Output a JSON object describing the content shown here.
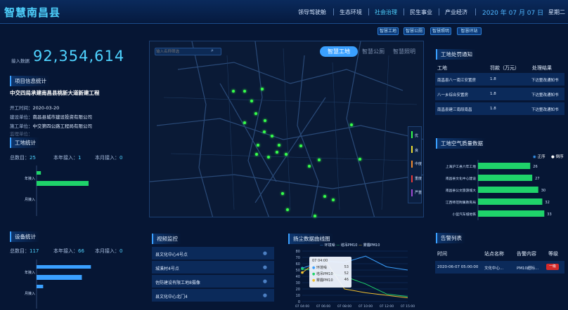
{
  "header": {
    "title": "智慧南昌县",
    "nav": [
      "领导驾驶舱",
      "生态环境",
      "社会治理",
      "民生事业",
      "产业经济"
    ],
    "nav_active": 2,
    "date": "2020 年 07 月 07 日",
    "weekday": "星期二"
  },
  "subnav": [
    "智慧工地",
    "智慧公厕",
    "智慧照明",
    "智慧环站"
  ],
  "left": {
    "access_label": "接入数据",
    "access_value": "92,354,614",
    "project": {
      "section": "项目信息统计",
      "name": "中交四局承建南昌县桃新大道新建工程",
      "start_label": "开工时间：",
      "start": "2020-03-20",
      "build_label": "建设单位：",
      "build": "南昌县城市建设投资有限公司",
      "construct_label": "施工单位：",
      "construct": "中交第四公路工程局有限公司",
      "extra_label": "监理单位："
    },
    "site": {
      "section": "工地统计",
      "total_label": "总数目：",
      "total": "25",
      "year_label": "本年接入：",
      "year": "1",
      "month_label": "本月接入：",
      "month": "0",
      "bars": [
        {
          "label": "年接入",
          "value": 1
        },
        {
          "label": "年接入",
          "value": 12
        },
        {
          "label": "月接入",
          "value": 0
        }
      ],
      "ticks": [
        "0",
        "2",
        "4",
        "6",
        "8",
        "10",
        "12"
      ]
    },
    "device": {
      "section": "设备统计",
      "total_label": "总数目：",
      "total": "117",
      "year_label": "本年接入：",
      "year": "66",
      "month_label": "本月接入：",
      "month": "0",
      "bars": [
        {
          "label": "年接入",
          "value": 66
        },
        {
          "label": "年接入",
          "value": 55
        },
        {
          "label": "月接入",
          "value": 8
        }
      ],
      "ticks": [
        "0",
        "10",
        "20",
        "30",
        "40",
        "50",
        "60",
        "70"
      ]
    }
  },
  "map": {
    "search_placeholder": "输入名称筛选",
    "tabs": [
      "智慧工地",
      "智慧公厕",
      "智慧照明"
    ],
    "legend": [
      "优",
      "良",
      "中度",
      "重度",
      "严重"
    ]
  },
  "video": {
    "section": "视频监控",
    "items": [
      "县文化中心4号点",
      "城溪村4号点",
      "佐防建设有限工地8摄像",
      "县文化中心北门4"
    ]
  },
  "dust": {
    "section": "扬尘数据曲线图",
    "legend": [
      "环境噪",
      "塔吊PM10",
      "雾霾PM10"
    ],
    "yticks": [
      "80",
      "70",
      "60",
      "50",
      "40",
      "30",
      "20",
      "10",
      "0"
    ],
    "xticks": [
      "07 04:00",
      "07 06:00",
      "07 08:00",
      "07 10:00",
      "07 12:00",
      "07 15:00"
    ],
    "tooltip": {
      "time": "07 04:00",
      "rows": [
        {
          "name": "环境噪",
          "value": "53"
        },
        {
          "name": "塔吊PM10",
          "value": "52"
        },
        {
          "name": "雾霾PM10",
          "value": "46"
        }
      ]
    }
  },
  "chart_data": [
    {
      "type": "bar",
      "title": "工地统计",
      "categories": [
        "年接入",
        "年接入",
        "月接入"
      ],
      "values": [
        1,
        12,
        0
      ],
      "xlim": [
        0,
        12
      ]
    },
    {
      "type": "bar",
      "title": "设备统计",
      "categories": [
        "年接入",
        "年接入",
        "月接入"
      ],
      "values": [
        66,
        55,
        8
      ],
      "xlim": [
        0,
        70
      ]
    },
    {
      "type": "line",
      "title": "扬尘数据曲线图",
      "x": [
        "07 04:00",
        "07 06:00",
        "07 08:00",
        "07 10:00",
        "07 12:00",
        "07 15:00"
      ],
      "series": [
        {
          "name": "环境噪",
          "values": [
            53,
            64,
            62,
            72,
            55,
            50
          ]
        },
        {
          "name": "塔吊PM10",
          "values": [
            52,
            47,
            40,
            28,
            12,
            8
          ]
        },
        {
          "name": "雾霾PM10",
          "values": [
            46,
            70,
            20,
            14,
            10,
            6
          ]
        }
      ],
      "ylim": [
        0,
        80
      ]
    },
    {
      "type": "bar",
      "title": "工地空气质量数据",
      "categories": [
        "上海沪工县六年工地",
        "南昌县文化中心建设",
        "南昌县公文旅游城大",
        "江西师范附属教育局",
        "小蓝汽车城地铁"
      ],
      "values": [
        26,
        27,
        30,
        32,
        33
      ]
    }
  ],
  "right": {
    "notice": {
      "section": "工地处罚通知",
      "cols": [
        "工地",
        "罚款（万元）",
        "处理结果"
      ],
      "rows": [
        {
          "site": "南昌县八一南江安置房",
          "fine": "1.8",
          "result": "下达整改通知书"
        },
        {
          "site": "八一乡综合安置房",
          "fine": "1.8",
          "result": "下达整改通知书"
        },
        {
          "site": "南昌县建三南段南昌",
          "fine": "1.8",
          "result": "下达整改通知书"
        }
      ]
    },
    "air": {
      "section": "工地空气质量数据",
      "radio_on": "正序",
      "radio_off": "倒序"
    },
    "alarm": {
      "section": "告警列表",
      "cols": [
        "时间",
        "站点名称",
        "告警内容",
        "等级"
      ],
      "rows": [
        {
          "time": "2020-06-07 05:00:00",
          "site": "文化中心...",
          "content": "PM10超标...",
          "level": "一级"
        }
      ]
    }
  },
  "colors": {
    "accent": "#3aa0ff",
    "green": "#1fd36a",
    "dot": "#36ff4a"
  }
}
